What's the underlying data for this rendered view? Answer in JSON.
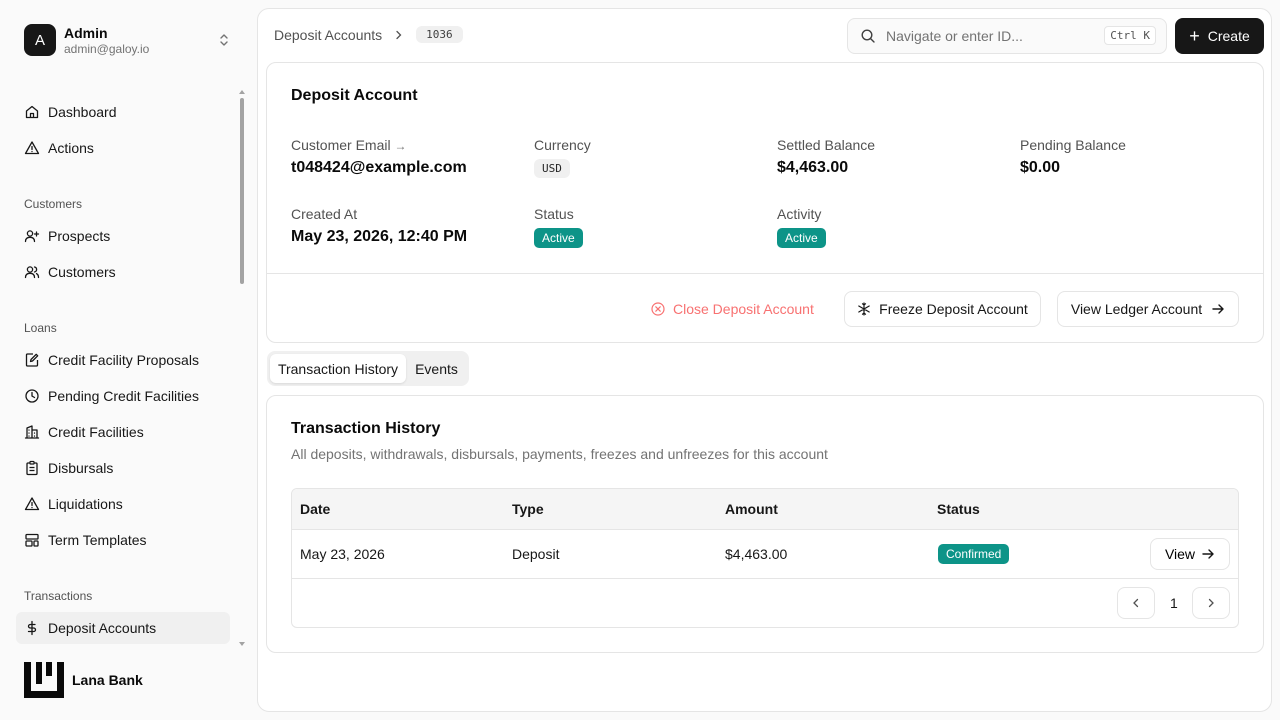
{
  "user": {
    "initial": "A",
    "name": "Admin",
    "email": "admin@galoy.io"
  },
  "nav": {
    "dashboard": "Dashboard",
    "actions": "Actions",
    "group_customers": "Customers",
    "prospects": "Prospects",
    "customers": "Customers",
    "group_loans": "Loans",
    "credit_facility_proposals": "Credit Facility Proposals",
    "pending_credit_facilities": "Pending Credit Facilities",
    "credit_facilities": "Credit Facilities",
    "disbursals": "Disbursals",
    "liquidations": "Liquidations",
    "term_templates": "Term Templates",
    "group_transactions": "Transactions",
    "deposit_accounts": "Deposit Accounts"
  },
  "brand": {
    "name": "Lana Bank"
  },
  "topbar": {
    "breadcrumb_parent": "Deposit Accounts",
    "breadcrumb_id": "1036",
    "search_placeholder": "Navigate or enter ID...",
    "shortcut": "Ctrl K",
    "create_label": "Create"
  },
  "account": {
    "title": "Deposit Account",
    "customer_email_label": "Customer Email",
    "customer_email": "t048424@example.com",
    "currency_label": "Currency",
    "currency": "USD",
    "settled_balance_label": "Settled Balance",
    "settled_balance": "$4,463.00",
    "pending_balance_label": "Pending Balance",
    "pending_balance": "$0.00",
    "created_at_label": "Created At",
    "created_at": "May 23, 2026, 12:40 PM",
    "status_label": "Status",
    "status": "Active",
    "activity_label": "Activity",
    "activity": "Active",
    "close_label": "Close Deposit Account",
    "freeze_label": "Freeze Deposit Account",
    "ledger_label": "View Ledger Account"
  },
  "tabs": {
    "history": "Transaction History",
    "events": "Events"
  },
  "history": {
    "title": "Transaction History",
    "description": "All deposits, withdrawals, disbursals, payments, freezes and unfreezes for this account",
    "columns": [
      "Date",
      "Type",
      "Amount",
      "Status"
    ],
    "rows": [
      {
        "date": "May 23, 2026",
        "type": "Deposit",
        "amount": "$4,463.00",
        "status": "Confirmed",
        "action": "View"
      }
    ],
    "page": "1"
  },
  "colors": {
    "accent": "#0d9488",
    "danger": "#f87171",
    "primary": "#171717"
  }
}
